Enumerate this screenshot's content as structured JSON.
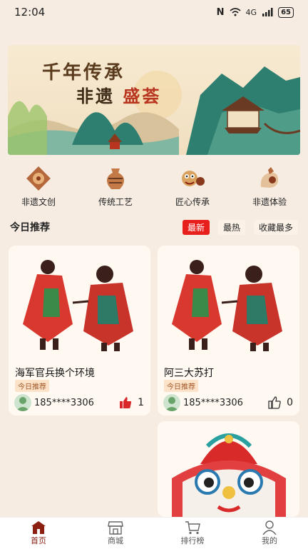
{
  "status_bar": {
    "time": "12:04",
    "network": "4G",
    "battery": "65"
  },
  "banner": {
    "title": "千年传承",
    "sub_black": "非遗",
    "sub_red": "盛荟"
  },
  "categories": [
    {
      "label": "非遗文创",
      "icon": "embroidery-icon"
    },
    {
      "label": "传统工艺",
      "icon": "pottery-icon"
    },
    {
      "label": "匠心传承",
      "icon": "lion-dance-icon"
    },
    {
      "label": "非遗体验",
      "icon": "craft-icon"
    }
  ],
  "section": {
    "title": "今日推荐",
    "filters": [
      "最新",
      "最热",
      "收藏最多"
    ],
    "active_filter": "最新"
  },
  "cards": [
    {
      "title": "海军官兵换个环境",
      "tag": "今日推荐",
      "user": "185****3306",
      "likes": "1",
      "liked": true
    },
    {
      "title": "阿三大苏打",
      "tag": "今日推荐",
      "user": "185****3306",
      "likes": "0",
      "liked": false
    }
  ],
  "tabs": [
    {
      "label": "首页",
      "icon": "home-icon",
      "active": true
    },
    {
      "label": "商城",
      "icon": "shop-icon",
      "active": false
    },
    {
      "label": "排行榜",
      "icon": "cart-icon",
      "active": false
    },
    {
      "label": "我的",
      "icon": "profile-icon",
      "active": false
    }
  ],
  "colors": {
    "accent": "#e8201d",
    "background": "#f6ece2",
    "brand": "#8a1f12"
  }
}
